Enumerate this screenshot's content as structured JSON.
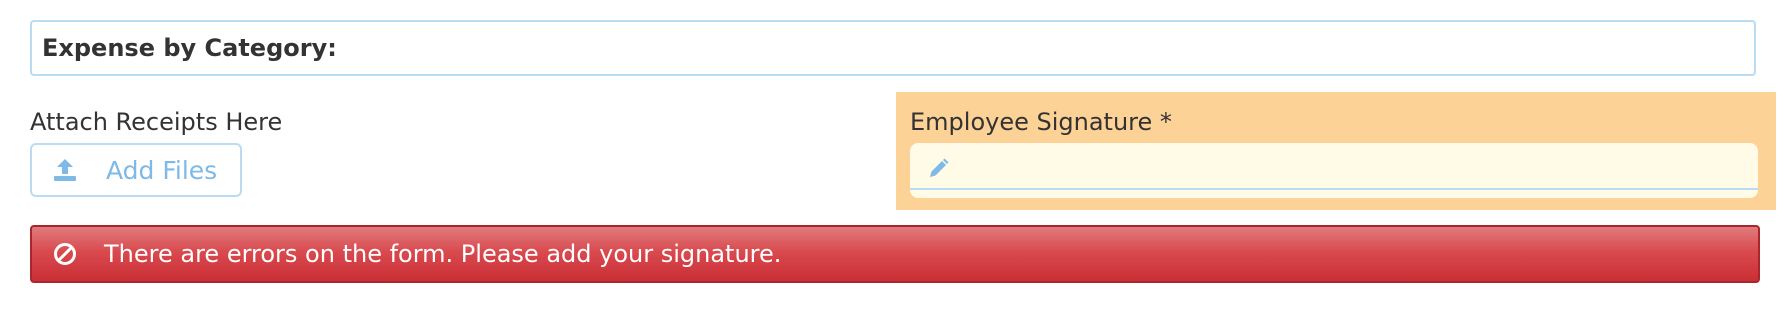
{
  "expense_section": {
    "title": "Expense by Category:"
  },
  "receipts": {
    "label": "Attach Receipts Here",
    "add_files_label": "Add Files",
    "icon": "upload-icon"
  },
  "signature": {
    "label": "Employee Signature *",
    "icon": "pencil-icon",
    "highlight_color": "#fdd296"
  },
  "error": {
    "message": "There are errors on the form. Please add your signature.",
    "icon": "prohibited-icon",
    "color": "#d94a4f"
  },
  "colors": {
    "accent": "#7fb9e6",
    "border": "#b9dcf2"
  }
}
